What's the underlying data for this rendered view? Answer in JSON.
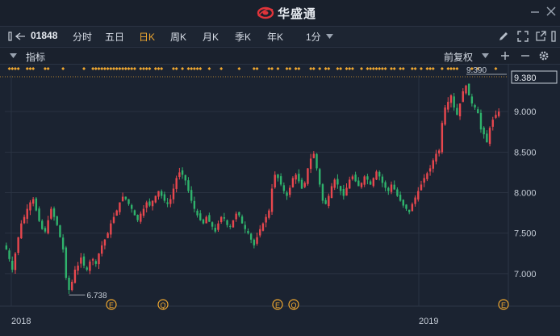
{
  "app": {
    "brand_name": "华盛通",
    "brand_icon": "huasheng-logo-icon"
  },
  "toolbar": {
    "stock_code": "01848",
    "periods": [
      {
        "label": "分时",
        "active": false
      },
      {
        "label": "五日",
        "active": false
      },
      {
        "label": "日K",
        "active": true
      },
      {
        "label": "周K",
        "active": false
      },
      {
        "label": "月K",
        "active": false
      },
      {
        "label": "季K",
        "active": false
      },
      {
        "label": "年K",
        "active": false
      }
    ],
    "minute_select": "1分",
    "accent_color": "#f0a830"
  },
  "indicator_bar": {
    "label": "指标",
    "adjust": "前复权"
  },
  "chart_data": {
    "type": "candlestick",
    "y_ticks": [
      "9.000",
      "8.500",
      "8.000",
      "7.500",
      "7.000"
    ],
    "y_range": [
      6.6,
      9.45
    ],
    "x_labels": [
      "2018",
      "2019"
    ],
    "current_price_label": "9.380",
    "high_marker": "9.390",
    "low_marker": "6.738",
    "event_markers": [
      {
        "label": "E"
      },
      {
        "label": "Q"
      },
      {
        "label": "E"
      },
      {
        "label": "Q"
      },
      {
        "label": "E"
      }
    ],
    "up_color": "#e8474e",
    "down_color": "#2fb36c",
    "dot_color": "#f0a830",
    "closes": [
      7.3,
      7.18,
      7.05,
      7.25,
      7.45,
      7.62,
      7.7,
      7.8,
      7.88,
      7.92,
      7.78,
      7.65,
      7.55,
      7.52,
      7.66,
      7.8,
      7.7,
      7.6,
      7.45,
      7.3,
      6.95,
      6.8,
      6.9,
      7.05,
      7.1,
      7.2,
      7.1,
      7.05,
      7.15,
      7.18,
      7.12,
      7.25,
      7.35,
      7.42,
      7.5,
      7.62,
      7.7,
      7.78,
      7.88,
      7.95,
      7.92,
      7.86,
      7.8,
      7.72,
      7.66,
      7.74,
      7.8,
      7.88,
      7.84,
      7.9,
      7.96,
      8.02,
      7.96,
      7.9,
      7.86,
      7.92,
      8.05,
      8.18,
      8.25,
      8.22,
      8.15,
      8.02,
      7.9,
      7.8,
      7.72,
      7.66,
      7.62,
      7.7,
      7.64,
      7.58,
      7.52,
      7.62,
      7.7,
      7.68,
      7.6,
      7.58,
      7.66,
      7.74,
      7.72,
      7.62,
      7.55,
      7.5,
      7.42,
      7.35,
      7.45,
      7.55,
      7.62,
      7.7,
      7.78,
      8.05,
      8.22,
      8.18,
      8.1,
      8.02,
      7.96,
      8.06,
      8.18,
      8.22,
      8.14,
      8.05,
      8.12,
      8.3,
      8.42,
      8.48,
      8.3,
      8.1,
      7.9,
      7.86,
      7.96,
      8.08,
      8.16,
      8.1,
      8.02,
      7.96,
      8.06,
      8.16,
      8.2,
      8.14,
      8.08,
      8.12,
      8.2,
      8.16,
      8.1,
      8.18,
      8.26,
      8.2,
      8.12,
      8.06,
      8.02,
      8.1,
      8.04,
      7.96,
      7.9,
      7.84,
      7.8,
      7.76,
      7.86,
      7.94,
      8.02,
      8.1,
      8.18,
      8.24,
      8.3,
      8.4,
      8.48,
      8.52,
      8.86,
      9.05,
      9.12,
      9.2,
      9.05,
      8.96,
      9.1,
      9.25,
      9.32,
      9.2,
      9.1,
      9.05,
      8.98,
      8.78,
      8.72,
      8.62,
      8.8,
      8.9,
      8.96,
      9.0
    ]
  }
}
